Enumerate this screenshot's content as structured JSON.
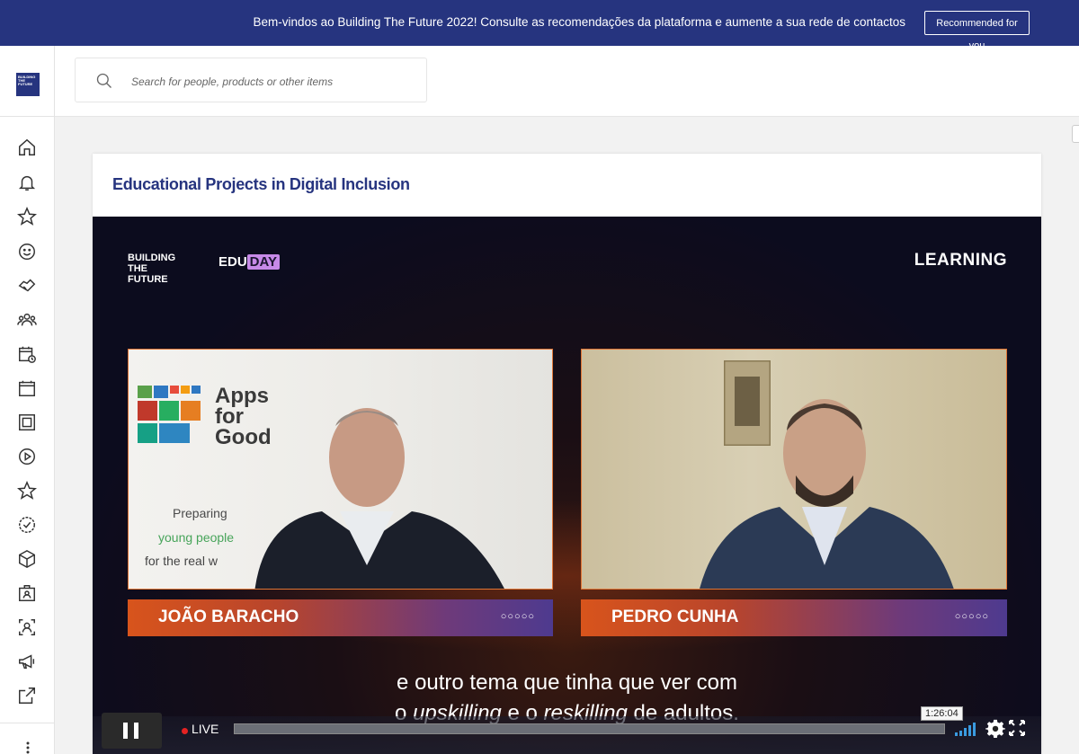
{
  "banner": {
    "message": "Bem-vindos ao Building The Future 2022! Consulte as recomendações da plataforma e aumente a sua rede de contactos",
    "button_label": "Recommended for you"
  },
  "logo": {
    "text": "BUILDING THE FUTURE"
  },
  "sidebar": {
    "icons": [
      "home-icon",
      "bell-icon",
      "star-icon",
      "smile-icon",
      "handshake-icon",
      "people-icon",
      "calendar-clock-icon",
      "calendar-icon",
      "frame-icon",
      "play-circle-icon",
      "star-outline-icon",
      "verified-badge-icon",
      "cube-icon",
      "id-badge-icon",
      "user-scan-icon",
      "megaphone-icon",
      "external-link-icon"
    ]
  },
  "search": {
    "placeholder": "Search for people, products or other items"
  },
  "card": {
    "title": "Educational Projects in Digital Inclusion"
  },
  "video": {
    "logo_lines": [
      "BUILDING",
      "THE",
      "FUTURE"
    ],
    "eduday_edu": "EDU",
    "eduday_day": "DAY",
    "category": "LEARNING",
    "left_panel": {
      "sign_title_lines": [
        "Apps",
        "for",
        "Good"
      ],
      "tagline_1": "Preparing",
      "tagline_2": "young people",
      "tagline_3": "for the real w"
    },
    "speakers": [
      {
        "name": "JOÃO BARACHO",
        "dots": "○○○○○"
      },
      {
        "name": "PEDRO CUNHA",
        "dots": "○○○○○"
      }
    ],
    "subtitle_line1": "e outro tema que tinha que ver com",
    "subtitle_line2_parts": [
      "o ",
      "upskilling",
      " e o ",
      "reskilling",
      " de adultos."
    ],
    "live_label": "LIVE",
    "time_tooltip": "1:26:04",
    "progress_fraction": 1.0
  },
  "colors": {
    "banner_bg": "#26347f",
    "title_color": "#26347f",
    "nameplate_orange": "#d8541c",
    "nameplate_purple": "#4e3a8f",
    "live_dot": "#e52222"
  }
}
